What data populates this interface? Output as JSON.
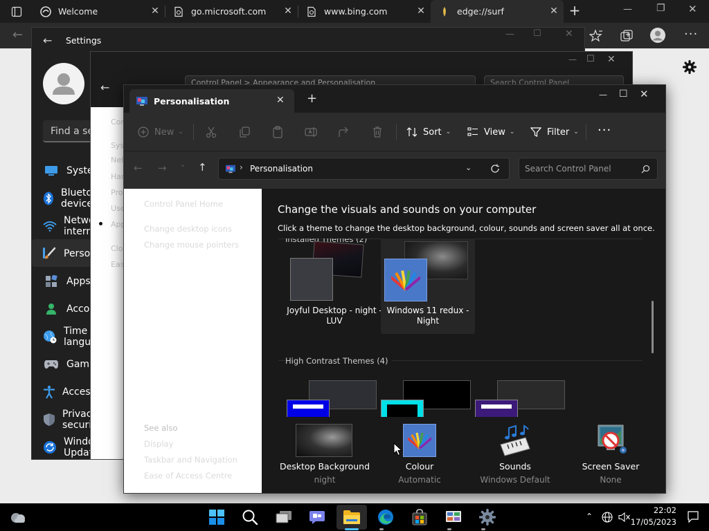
{
  "browser": {
    "tabs": [
      {
        "title": "Welcome",
        "icon": "edge-icon"
      },
      {
        "title": "go.microsoft.com",
        "icon": "page-icon"
      },
      {
        "title": "www.bing.com",
        "icon": "page-icon"
      },
      {
        "title": "edge://surf",
        "icon": "surf-icon"
      }
    ]
  },
  "settings": {
    "title": "Settings",
    "search_placeholder": "Find a setting",
    "nav_items": [
      {
        "label": "System",
        "icon": "monitor-icon"
      },
      {
        "label": "Bluetooth & devices",
        "icon": "bluetooth-icon"
      },
      {
        "label": "Network & internet",
        "icon": "wifi-icon"
      },
      {
        "label": "Personalisation",
        "icon": "brush-icon"
      },
      {
        "label": "Apps",
        "icon": "apps-icon"
      },
      {
        "label": "Accounts",
        "icon": "person-icon"
      },
      {
        "label": "Time & language",
        "icon": "globe-icon"
      },
      {
        "label": "Gaming",
        "icon": "gamepad-icon"
      },
      {
        "label": "Accessibility",
        "icon": "accessibility-icon"
      },
      {
        "label": "Privacy & security",
        "icon": "shield-icon"
      },
      {
        "label": "Windows Update",
        "icon": "update-icon"
      }
    ]
  },
  "control_panel_back": {
    "address": "Control Panel > Appearance and Personalisation",
    "search_placeholder": "Search Control Panel",
    "side_items": [
      "Control Panel Home",
      "System",
      "Network",
      "Hardware",
      "Programs",
      "User Accounts",
      "Appearance and Personalisation",
      "Clock and Region",
      "Ease of Access"
    ]
  },
  "explorer": {
    "tab_title": "Personalisation",
    "toolbar": {
      "new": "New",
      "sort": "Sort",
      "view": "View",
      "filter": "Filter"
    },
    "address": "Personalisation",
    "search_placeholder": "Search Control Panel",
    "left_links": [
      "Control Panel Home",
      "Change desktop icons",
      "Change mouse pointers"
    ],
    "see_also_title": "See also",
    "see_also": [
      "Display",
      "Taskbar and Navigation",
      "Ease of Access Centre"
    ],
    "heading": "Change the visuals and sounds on your computer",
    "subheading": "Click a theme to change the desktop background, colour, sounds and screen saver all at once.",
    "installed_group": "Installed Themes (2)",
    "themes": [
      {
        "name": "Joyful Desktop - night - LUV"
      },
      {
        "name": "Windows 11 redux - Night"
      }
    ],
    "high_contrast_group": "High Contrast Themes (4)",
    "bottom": [
      {
        "label": "Desktop Background",
        "value": "night",
        "icon": "picture-icon"
      },
      {
        "label": "Colour",
        "value": "Automatic",
        "icon": "colour-palette-icon"
      },
      {
        "label": "Sounds",
        "value": "Windows Default",
        "icon": "sounds-icon"
      },
      {
        "label": "Screen Saver",
        "value": "None",
        "icon": "screensaver-icon"
      }
    ]
  },
  "taskbar": {
    "time": "22:02",
    "date": "17/05/2023"
  }
}
